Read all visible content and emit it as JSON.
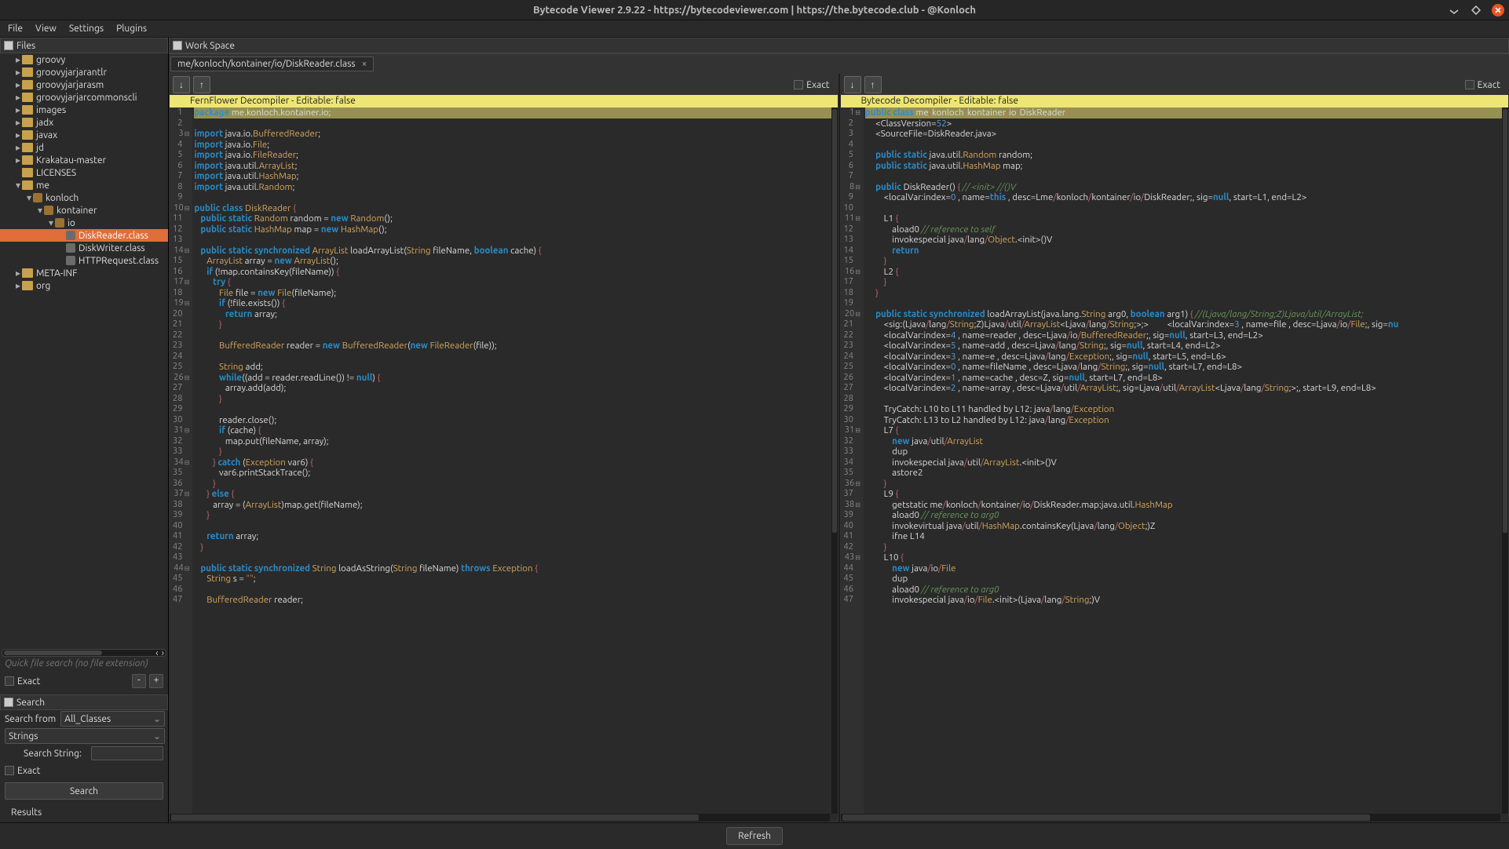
{
  "title": "Bytecode Viewer 2.9.22 - https://bytecodeviewer.com | https://the.bytecode.club - @Konloch",
  "menubar": [
    "File",
    "View",
    "Settings",
    "Plugins"
  ],
  "files": {
    "header": "Files",
    "tree": [
      {
        "d": 1,
        "t": "folder",
        "e": "▸",
        "l": "groovy"
      },
      {
        "d": 1,
        "t": "folder",
        "e": "▸",
        "l": "groovyjarjarantlr"
      },
      {
        "d": 1,
        "t": "folder",
        "e": "▸",
        "l": "groovyjarjarasm"
      },
      {
        "d": 1,
        "t": "folder",
        "e": "▸",
        "l": "groovyjarjarcommonscli"
      },
      {
        "d": 1,
        "t": "folder",
        "e": "▸",
        "l": "images"
      },
      {
        "d": 1,
        "t": "folder",
        "e": "▸",
        "l": "jadx"
      },
      {
        "d": 1,
        "t": "folder",
        "e": "▸",
        "l": "javax"
      },
      {
        "d": 1,
        "t": "folder",
        "e": "▸",
        "l": "jd"
      },
      {
        "d": 1,
        "t": "folder",
        "e": "▸",
        "l": "Krakatau-master"
      },
      {
        "d": 1,
        "t": "folder",
        "e": "",
        "l": "LICENSES"
      },
      {
        "d": 1,
        "t": "folder",
        "e": "▾",
        "l": "me"
      },
      {
        "d": 2,
        "t": "pkg",
        "e": "▾",
        "l": "konloch"
      },
      {
        "d": 3,
        "t": "pkg",
        "e": "▾",
        "l": "kontainer"
      },
      {
        "d": 4,
        "t": "pkg",
        "e": "▾",
        "l": "io"
      },
      {
        "d": 5,
        "t": "cls",
        "e": "",
        "l": "DiskReader.class",
        "sel": true
      },
      {
        "d": 5,
        "t": "cls",
        "e": "",
        "l": "DiskWriter.class"
      },
      {
        "d": 5,
        "t": "cls",
        "e": "",
        "l": "HTTPRequest.class"
      },
      {
        "d": 1,
        "t": "folder",
        "e": "▸",
        "l": "META-INF"
      },
      {
        "d": 1,
        "t": "folder",
        "e": "▸",
        "l": "org"
      }
    ],
    "filter_placeholder": "Quick file search (no file extension)",
    "exact": "Exact",
    "minus": "-",
    "plus": "+"
  },
  "search": {
    "header": "Search",
    "from_label": "Search from",
    "from_value": "All_Classes",
    "type_value": "Strings",
    "string_label": "Search String:",
    "exact": "Exact",
    "button": "Search",
    "results": "Results"
  },
  "workspace": {
    "header": "Work Space",
    "tab": "me/konloch/kontainer/io/DiskReader.class",
    "exact": "Exact",
    "refresh": "Refresh"
  },
  "pane_left": {
    "title": "FernFlower Decompiler - Editable: false",
    "first_line": 1,
    "folds": [
      3,
      10,
      14,
      17,
      19,
      26,
      31,
      34,
      37,
      44
    ],
    "code_html": [
      "<span class='hl'><span class='kw'>package</span> me.konloch.kontainer.io;</span>",
      "",
      "<span class='kw'>import</span> java.io.<span class='typ'>BufferedReader</span>;",
      "<span class='kw'>import</span> java.io.<span class='typ'>File</span>;",
      "<span class='kw'>import</span> java.io.<span class='typ'>FileReader</span>;",
      "<span class='kw'>import</span> java.util.<span class='typ'>ArrayList</span>;",
      "<span class='kw'>import</span> java.util.<span class='typ'>HashMap</span>;",
      "<span class='kw'>import</span> java.util.<span class='typ'>Random</span>;",
      "",
      "<span class='kw'>public class</span> <span class='typ'>DiskReader</span> <span class='err'>{</span>",
      "   <span class='kw'>public static</span> <span class='typ'>Random</span> random = <span class='kw'>new</span> <span class='typ'>Random</span>();",
      "   <span class='kw'>public static</span> <span class='typ'>HashMap</span> map = <span class='kw'>new</span> <span class='typ'>HashMap</span>();",
      "",
      "   <span class='kw'>public static synchronized</span> <span class='typ'>ArrayList</span> loadArrayList(<span class='typ'>String</span> fileName, <span class='kw'>boolean</span> cache) <span class='err'>{</span>",
      "      <span class='typ'>ArrayList</span> array = <span class='kw'>new</span> <span class='typ'>ArrayList</span>();",
      "      <span class='kw'>if</span> (!map.containsKey(fileName)) <span class='err'>{</span>",
      "         <span class='kw'>try</span> <span class='err'>{</span>",
      "            <span class='typ'>File</span> file = <span class='kw'>new</span> <span class='typ'>File</span>(fileName);",
      "            <span class='kw'>if</span> (!file.exists()) <span class='err'>{</span>",
      "               <span class='kw'>return</span> array;",
      "            <span class='err'>}</span>",
      "",
      "            <span class='typ'>BufferedReader</span> reader = <span class='kw'>new</span> <span class='typ'>BufferedReader</span>(<span class='kw'>new</span> <span class='typ'>FileReader</span>(file));",
      "",
      "            <span class='typ'>String</span> add;",
      "            <span class='kw'>while</span>((add = reader.readLine()) != <span class='kw'>null</span>) <span class='err'>{</span>",
      "               array.add(add);",
      "            <span class='err'>}</span>",
      "",
      "            reader.close();",
      "            <span class='kw'>if</span> (cache) <span class='err'>{</span>",
      "               map.put(fileName, array);",
      "            <span class='err'>}</span>",
      "         <span class='err'>}</span> <span class='kw'>catch</span> (<span class='typ'>Exception</span> var6) <span class='err'>{</span>",
      "            var6.printStackTrace();",
      "         <span class='err'>}</span>",
      "      <span class='err'>}</span> <span class='kw'>else</span> <span class='err'>{</span>",
      "         array = (<span class='typ'>ArrayList</span>)map.get(fileName);",
      "      <span class='err'>}</span>",
      "",
      "      <span class='kw'>return</span> array;",
      "   <span class='err'>}</span>",
      "",
      "   <span class='kw'>public static synchronized</span> <span class='typ'>String</span> loadAsString(<span class='typ'>String</span> fileName) <span class='kw'>throws</span> <span class='typ'>Exception</span> <span class='err'>{</span>",
      "      <span class='typ'>String</span> s = <span class='str'>\"\"</span>;",
      "",
      "      <span class='typ'>BufferedReader</span> reader;"
    ]
  },
  "pane_right": {
    "title": "Bytecode Decompiler - Editable: false",
    "first_line": 1,
    "folds": [
      1,
      8,
      11,
      16,
      20,
      31,
      36,
      38,
      43
    ],
    "code_html": [
      "<span class='hl'><span class='kw'>public class</span> me<span class='err'>/</span>konloch<span class='err'>/</span>kontainer<span class='err'>/</span>io<span class='err'>/</span>DiskReader <span class='err'>{</span></span>",
      "     &lt;ClassVersion=<span class='num'>52</span>&gt;",
      "     &lt;SourceFile=DiskReader.java&gt;",
      "",
      "     <span class='kw'>public static</span> java.util.<span class='typ'>Random</span> random;",
      "     <span class='kw'>public static</span> java.util.<span class='typ'>HashMap</span> map;",
      "",
      "     <span class='kw'>public</span> DiskReader() <span class='err'>{</span> <span class='cmt'>// &lt;init&gt;</span> <span class='cmt'>//()V</span>",
      "         &lt;localVar:index=<span class='num'>0</span> , name=<span class='kw'>this</span> , desc=Lme<span class='err'>/</span>konloch<span class='err'>/</span>kontainer<span class='err'>/</span>io<span class='err'>/</span>DiskReader;, sig=<span class='kw'>null</span>, start=L1, end=L2&gt;",
      "",
      "         L1 <span class='err'>{</span>",
      "             aload0 <span class='cmt'>// reference to self</span>",
      "             invokespecial java<span class='err'>/</span>lang<span class='err'>/</span><span class='typ'>Object</span>.&lt;init&gt;()V",
      "             <span class='kw'>return</span>",
      "         <span class='err'>}</span>",
      "         L2 <span class='err'>{</span>",
      "         <span class='err'>}</span>",
      "     <span class='err'>}</span>",
      "",
      "     <span class='kw'>public static synchronized</span> loadArrayList(java.lang.<span class='typ'>String</span> arg0, <span class='kw'>boolean</span> arg1) <span class='err'>{</span> <span class='cmt'>//(Ljava/lang/String;Z)Ljava/util/ArrayList;</span>",
      "         &lt;sig:(Ljava<span class='err'>/</span>lang<span class='err'>/</span><span class='typ'>String</span>;Z)Ljava<span class='err'>/</span>util<span class='err'>/</span><span class='typ'>ArrayList</span>&lt;Ljava<span class='err'>/</span>lang<span class='err'>/</span><span class='typ'>String</span>;&gt;;&gt;         &lt;localVar:index=<span class='num'>3</span> , name=file , desc=Ljava<span class='err'>/</span>io<span class='err'>/</span><span class='typ'>File</span>;, sig=<span class='kw'>nu</span>",
      "         &lt;localVar:index=<span class='num'>4</span> , name=reader , desc=Ljava<span class='err'>/</span>io<span class='err'>/</span><span class='typ'>BufferedReader</span>;, sig=<span class='kw'>null</span>, start=L3, end=L2&gt;",
      "         &lt;localVar:index=<span class='num'>5</span> , name=add , desc=Ljava<span class='err'>/</span>lang<span class='err'>/</span><span class='typ'>String</span>;, sig=<span class='kw'>null</span>, start=L4, end=L2&gt;",
      "         &lt;localVar:index=<span class='num'>3</span> , name=e , desc=Ljava<span class='err'>/</span>lang<span class='err'>/</span><span class='typ'>Exception</span>;, sig=<span class='kw'>null</span>, start=L5, end=L6&gt;",
      "         &lt;localVar:index=<span class='num'>0</span> , name=fileName , desc=Ljava<span class='err'>/</span>lang<span class='err'>/</span><span class='typ'>String</span>;, sig=<span class='kw'>null</span>, start=L7, end=L8&gt;",
      "         &lt;localVar:index=<span class='num'>1</span> , name=cache , desc=Z, sig=<span class='kw'>null</span>, start=L7, end=L8&gt;",
      "         &lt;localVar:index=<span class='num'>2</span> , name=array , desc=Ljava<span class='err'>/</span>util<span class='err'>/</span><span class='typ'>ArrayList</span>;, sig=Ljava<span class='err'>/</span>util<span class='err'>/</span><span class='typ'>ArrayList</span>&lt;Ljava<span class='err'>/</span>lang<span class='err'>/</span><span class='typ'>String</span>;&gt;;, start=L9, end=L8&gt;",
      "",
      "         TryCatch: L10 to L11 handled by L12: java<span class='err'>/</span>lang<span class='err'>/</span><span class='typ'>Exception</span>",
      "         TryCatch: L13 to L2 handled by L12: java<span class='err'>/</span>lang<span class='err'>/</span><span class='typ'>Exception</span>",
      "         L7 <span class='err'>{</span>",
      "             <span class='kw'>new</span> java<span class='err'>/</span>util<span class='err'>/</span><span class='typ'>ArrayList</span>",
      "             dup",
      "             invokespecial java<span class='err'>/</span>util<span class='err'>/</span><span class='typ'>ArrayList</span>.&lt;init&gt;()V",
      "             astore2",
      "         <span class='err'>}</span>",
      "         L9 <span class='err'>{</span>",
      "             getstatic me<span class='err'>/</span>konloch<span class='err'>/</span>kontainer<span class='err'>/</span>io<span class='err'>/</span>DiskReader.map:java.util.<span class='typ'>HashMap</span>",
      "             aload0 <span class='cmt'>// reference to arg0</span>",
      "             invokevirtual java<span class='err'>/</span>util<span class='err'>/</span><span class='typ'>HashMap</span>.containsKey(Ljava<span class='err'>/</span>lang<span class='err'>/</span><span class='typ'>Object</span>;)Z",
      "             ifne L14",
      "         <span class='err'>}</span>",
      "         L10 <span class='err'>{</span>",
      "             <span class='kw'>new</span> java<span class='err'>/</span>io<span class='err'>/</span><span class='typ'>File</span>",
      "             dup",
      "             aload0 <span class='cmt'>// reference to arg0</span>",
      "             invokespecial java<span class='err'>/</span>io<span class='err'>/</span><span class='typ'>File</span>.&lt;init&gt;(Ljava<span class='err'>/</span>lang<span class='err'>/</span><span class='typ'>String</span>;)V"
    ]
  }
}
